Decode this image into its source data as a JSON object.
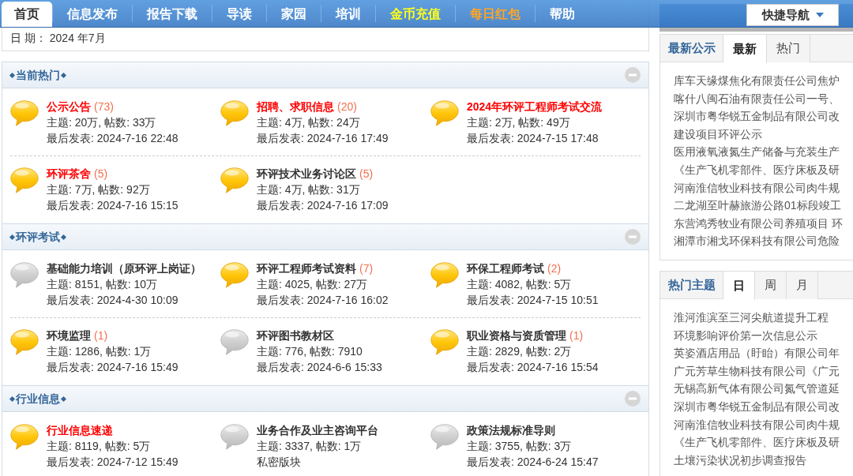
{
  "nav": {
    "items": [
      {
        "label": "首页",
        "selected": true
      },
      {
        "label": "信息发布",
        "selected": false
      },
      {
        "label": "报告下载",
        "selected": false
      },
      {
        "label": "导读",
        "selected": false
      },
      {
        "label": "家园",
        "selected": false
      },
      {
        "label": "培训",
        "selected": false
      },
      {
        "label": "金币充值",
        "selected": false,
        "color": "#ffff1a"
      },
      {
        "label": "每日红包",
        "selected": false,
        "color": "#ffa524"
      },
      {
        "label": "帮助",
        "selected": false
      }
    ],
    "quick_nav": {
      "label": "快捷导航"
    }
  },
  "info_box": {
    "date_line": "日 期： 2024 年7月"
  },
  "sections": [
    {
      "title": "当前热门",
      "forums": [
        {
          "name": "公示公告",
          "count": "(73)",
          "highlighted": true,
          "has_new": true,
          "stats": "主题: 20万, 帖数: 33万",
          "last": "最后发表: 2024-7-16 22:48"
        },
        {
          "name": "招聘、求职信息",
          "count": "(20)",
          "highlighted": true,
          "has_new": true,
          "stats": "主题: 4万, 帖数: 24万",
          "last": "最后发表: 2024-7-16 17:49"
        },
        {
          "name": "2024年环评工程师考试交流",
          "highlighted": true,
          "has_new": true,
          "stats": "主题: 2万, 帖数: 49万",
          "last": "最后发表: 2024-7-15 17:48"
        },
        {
          "name": "环评茶舍",
          "count": "(5)",
          "highlighted": true,
          "has_new": true,
          "stats": "主题: 7万, 帖数: 92万",
          "last": "最后发表: 2024-7-16 15:15"
        },
        {
          "name": "环评技术业务讨论区",
          "count": "(5)",
          "highlighted": false,
          "has_new": true,
          "stats": "主题: 4万, 帖数: 31万",
          "last": "最后发表: 2024-7-16 17:09"
        }
      ]
    },
    {
      "title": "环评考试",
      "forums": [
        {
          "name": "基础能力培训（原环评上岗证）",
          "highlighted": false,
          "has_new": false,
          "stats": "主题: 8151, 帖数: 10万",
          "last": "最后发表: 2024-4-30 10:09"
        },
        {
          "name": "环评工程师考试资料",
          "count": "(7)",
          "highlighted": false,
          "has_new": true,
          "stats": "主题: 4025, 帖数: 27万",
          "last": "最后发表: 2024-7-16 16:02"
        },
        {
          "name": "环保工程师考试",
          "count": "(2)",
          "highlighted": false,
          "has_new": true,
          "stats": "主题: 4082, 帖数: 5万",
          "last": "最后发表: 2024-7-15 10:51"
        },
        {
          "name": "环境监理",
          "count": "(1)",
          "highlighted": false,
          "has_new": true,
          "stats": "主题: 1286, 帖数: 1万",
          "last": "最后发表: 2024-7-16 15:49"
        },
        {
          "name": "环评图书教材区",
          "highlighted": false,
          "has_new": false,
          "stats": "主题: 776, 帖数: 7910",
          "last": "最后发表: 2024-6-6 15:33"
        },
        {
          "name": "职业资格与资质管理",
          "count": "(1)",
          "highlighted": false,
          "has_new": true,
          "stats": "主题: 2829, 帖数: 2万",
          "last": "最后发表: 2024-7-16 15:54"
        }
      ]
    },
    {
      "title": "行业信息",
      "forums": [
        {
          "name": "行业信息速递",
          "highlighted": true,
          "has_new": true,
          "stats": "主题: 8119, 帖数: 5万",
          "last": "最后发表: 2024-7-12 15:49"
        },
        {
          "name": "业务合作及业主咨询平台",
          "highlighted": false,
          "has_new": false,
          "stats": "主题: 3337, 帖数: 1万",
          "last": "私密版块"
        },
        {
          "name": "政策法规标准导则",
          "highlighted": false,
          "has_new": false,
          "stats": "主题: 3755, 帖数: 3万",
          "last": "最后发表: 2024-6-24 15:47"
        }
      ]
    }
  ],
  "sidebar": {
    "panels": [
      {
        "title": "最新公示",
        "tabs": [
          {
            "label": "最新",
            "selected": true
          },
          {
            "label": "热门",
            "selected": false
          }
        ],
        "items": [
          "库车天缘煤焦化有限责任公司焦炉",
          "喀什八闽石油有限责任公司一号、",
          "深圳市粤华锐五金制品有限公司改",
          "建设项目环评公示",
          "医用液氧液氮生产储备与充装生产",
          "《生产飞机零部件、医疗床板及研",
          "河南淮信牧业科技有限公司肉牛规",
          "二龙湖至叶赫旅游公路01标段竣工",
          "东营鸿秀牧业有限公司养殖项目 环",
          "湘潭市湘戈环保科技有限公司危险"
        ]
      },
      {
        "title": "热门主题",
        "tabs": [
          {
            "label": "日",
            "selected": true
          },
          {
            "label": "周",
            "selected": false
          },
          {
            "label": "月",
            "selected": false
          }
        ],
        "items": [
          "淮河淮滨至三河尖航道提升工程",
          "环境影响评价第一次信息公示",
          "英姿酒店用品（盱眙）有限公司年",
          "广元芳草生物科技有限公司《广元",
          "无锡高新气体有限公司氮气管道延",
          "深圳市粤华锐五金制品有限公司改",
          "河南淮信牧业科技有限公司肉牛规",
          "《生产飞机零部件、医疗床板及研",
          "土壤污染状况初步调查报告"
        ]
      }
    ]
  }
}
